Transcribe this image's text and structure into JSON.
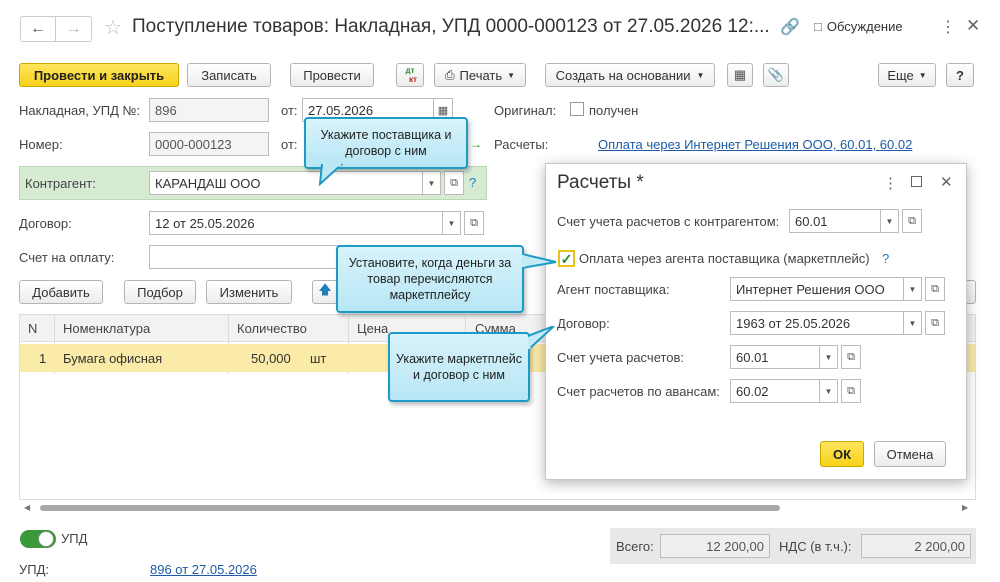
{
  "window": {
    "title": "Поступление товаров: Накладная, УПД 0000-000123 от 27.05.2026 12:...",
    "discussion_label": "Обсуждение",
    "colors": {
      "accent": "#f7d21a",
      "link": "#1f5aa6",
      "callout_border": "#1e9ac6",
      "contractor_bg": "#d7ebd3"
    }
  },
  "toolbar": {
    "post_close": "Провести и закрыть",
    "save": "Записать",
    "post": "Провести",
    "dtkt_top": "дт",
    "dtkt_bottom": "кт",
    "print": "Печать",
    "create_based": "Создать на основании",
    "more": "Еще",
    "help": "?"
  },
  "form": {
    "invoice_label": "Накладная, УПД №:",
    "invoice_value": "896",
    "from_label": "от:",
    "invoice_date": "27.05.2026",
    "original_label": "Оригинал:",
    "original_received": "получен",
    "number_label": "Номер:",
    "number_value": "0000-000123",
    "from_label2": "от:",
    "settlements_label": "Расчеты:",
    "settlements_link": "Оплата через Интернет Решения ООО, 60.01, 60.02",
    "contractor_label": "Контрагент:",
    "contractor_value": "КАРАНДАШ ООО",
    "contract_label": "Договор:",
    "contract_value": "12 от 25.05.2026",
    "payment_account_label": "Счет на оплату:",
    "upd_toggle_label": "УПД",
    "upd_label": "УПД:",
    "upd_link": "896 от 27.05.2026",
    "total_label": "Всего:",
    "total_value": "12 200,00",
    "vat_label": "НДС (в т.ч.):",
    "vat_value": "2 200,00"
  },
  "table_toolbar": {
    "add": "Добавить",
    "select": "Подбор",
    "edit": "Изменить"
  },
  "table": {
    "headers": [
      "N",
      "Номенклатура",
      "Количество",
      "Цена",
      "Сумма"
    ],
    "rows": [
      {
        "n": "1",
        "item": "Бумага офисная",
        "qty": "50,000",
        "unit": "шт"
      }
    ]
  },
  "dialog": {
    "title": "Расчеты *",
    "contractor_account_label": "Счет учета расчетов с контрагентом:",
    "contractor_account_value": "60.01",
    "agent_checkbox_label": "Оплата через агента поставщика (маркетплейс)",
    "agent_help": "?",
    "agent_label": "Агент поставщика:",
    "agent_value": "Интернет Решения ООО",
    "contract_label": "Договор:",
    "contract_value": "1963 от 25.05.2026",
    "account_label": "Счет учета расчетов:",
    "account_value": "60.01",
    "advance_label": "Счет расчетов по авансам:",
    "advance_value": "60.02",
    "ok": "ОК",
    "cancel": "Отмена"
  },
  "callouts": {
    "supplier": "Укажите поставщика и договор с ним",
    "agent_when": "Установите, когда деньги за товар перечисляются маркетплейсу",
    "marketplace": "Укажите маркетплейс и договор с ним"
  }
}
